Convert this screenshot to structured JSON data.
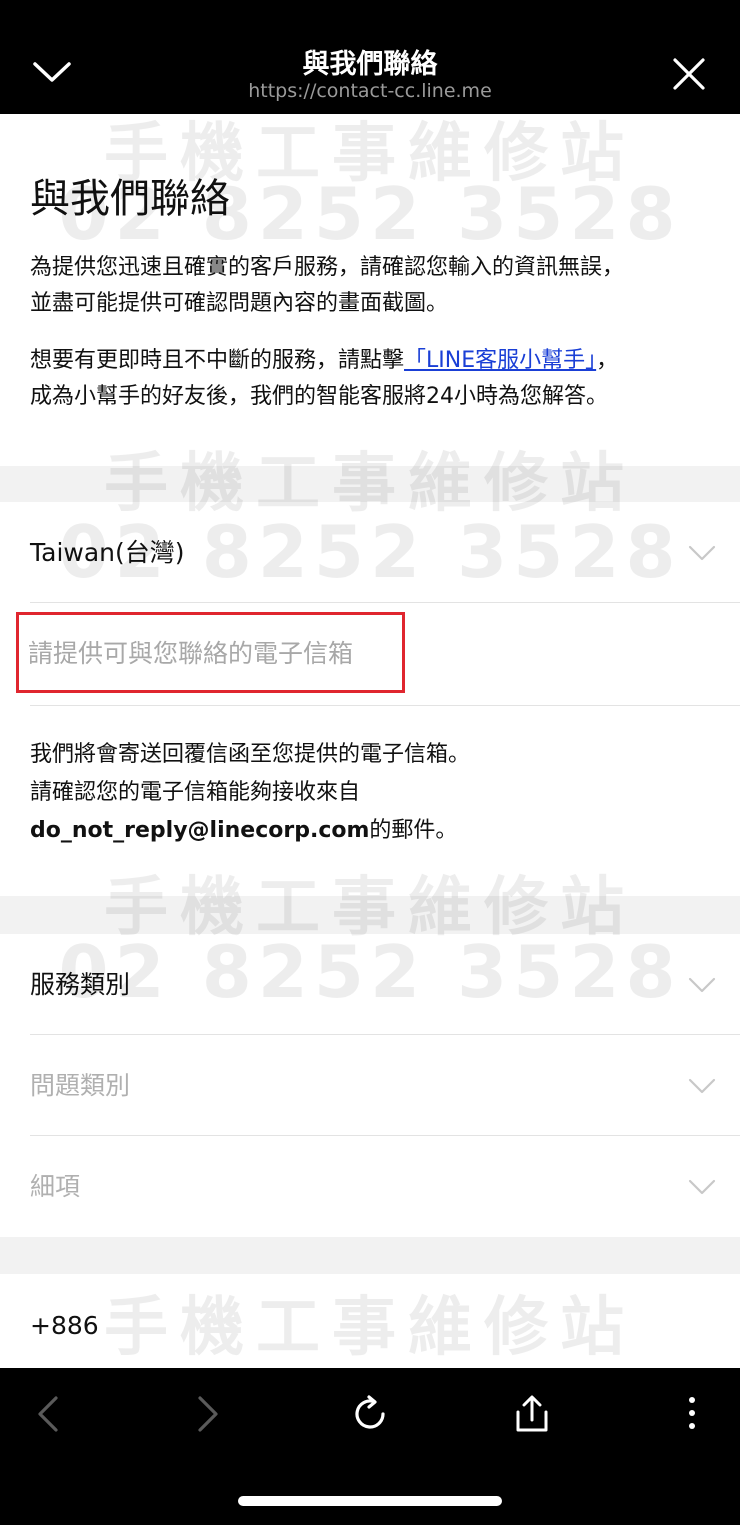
{
  "header": {
    "title": "與我們聯絡",
    "url": "https://contact-cc.line.me",
    "collapse_icon": "chevron-down-icon",
    "close_icon": "close-icon"
  },
  "watermark": {
    "text": "手機工事維修站",
    "phone": "02 8252 3528"
  },
  "main": {
    "heading": "與我們聯絡",
    "intro_line1": "為提供您迅速且確實的客戶服務，請確認您輸入的資訊無誤，",
    "intro_line2": "並盡可能提供可確認問題內容的畫面截圖。",
    "helper_prefix": "想要有更即時且不中斷的服務，請點擊",
    "helper_link": "「LINE客服小幫手」",
    "helper_mid": "，",
    "helper_line2": "成為小幫手的好友後，我們的智能客服將24小時為您解答。"
  },
  "form": {
    "country": "Taiwan(台灣)",
    "email_placeholder": "請提供可與您聯絡的電子信箱",
    "email_value": "",
    "note_line1": "我們將會寄送回覆信函至您提供的電子信箱。",
    "note_line2": "請確認您的電子信箱能夠接收來自",
    "note_email": "do_not_reply@linecorp.com",
    "note_suffix": "的郵件。",
    "service_category": "服務類別",
    "issue_category": "問題類別",
    "detail": "細項",
    "phone_code": "+886"
  },
  "toolbar": {
    "back_icon": "back-arrow-icon",
    "forward_icon": "forward-arrow-icon",
    "reload_icon": "reload-icon",
    "share_icon": "share-icon",
    "more_icon": "more-vertical-icon"
  },
  "colors": {
    "link": "#1a3fd6",
    "highlight": "#e0262f",
    "bar": "#000000",
    "section_gap": "#f2f2f2"
  }
}
